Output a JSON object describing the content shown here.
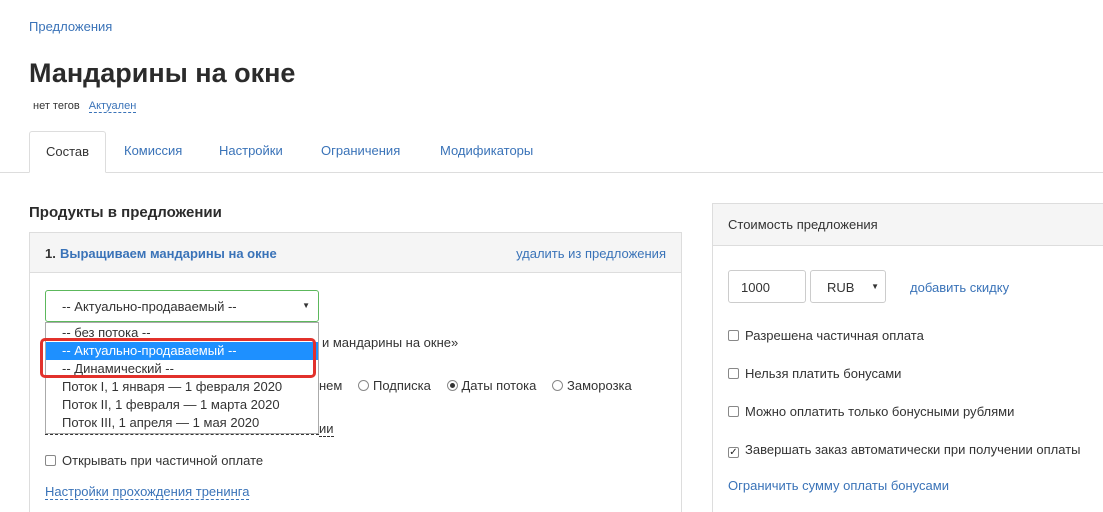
{
  "breadcrumb": "Предложения",
  "title": "Мандарины на окне",
  "tags": {
    "no_tags": "нет тегов",
    "status": "Актуален"
  },
  "tabs": [
    "Состав",
    "Комиссия",
    "Настройки",
    "Ограничения",
    "Модификаторы"
  ],
  "products_section": {
    "title": "Продукты в предложении",
    "item_number": "1.",
    "item_name": "Выращиваем мандарины на окне",
    "remove_label": "удалить из предложения",
    "stream_select_value": "-- Актуально-продаваемый --",
    "stream_options": [
      "-- без потока --",
      "-- Актуально-продаваемый --",
      "-- Динамический --",
      "Поток I, 1 января — 1 февраля 2020",
      "Поток II, 1 февраля — 1 марта 2020",
      "Поток III, 1 апреля — 1 мая 2020"
    ],
    "selected_option_index": 1,
    "behind_text_fragment": "и мандарины на окне»",
    "access_option_fragment": "нем",
    "access_options": [
      {
        "label": "Подписка",
        "checked": false
      },
      {
        "label": "Даты потока",
        "checked": true
      },
      {
        "label": "Заморозка",
        "checked": false
      }
    ],
    "dashed_fragment": "ии",
    "open_partial_label": "Открывать при частичной оплате",
    "training_settings_link": "Настройки прохождения тренинга"
  },
  "price_section": {
    "title": "Стоимость предложения",
    "amount": "1000",
    "currency": "RUB",
    "add_discount": "добавить скидку",
    "options": [
      {
        "label": "Разрешена частичная оплата",
        "checked": false
      },
      {
        "label": "Нельзя платить бонусами",
        "checked": false
      },
      {
        "label": "Можно оплатить только бонусными рублями",
        "checked": false
      },
      {
        "label": "Завершать заказ автоматически при получении оплаты",
        "checked": true
      }
    ],
    "limit_bonus_link": "Ограничить сумму оплаты бонусами"
  },
  "colors": {
    "link": "#3a73b8",
    "highlight": "#e2312b",
    "selected_option": "#1e90ff"
  }
}
